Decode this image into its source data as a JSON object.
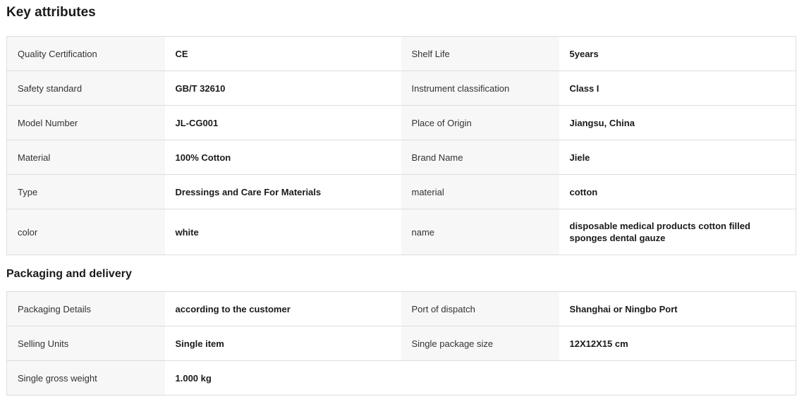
{
  "key_attributes": {
    "title": "Key attributes",
    "rows": [
      [
        "Quality Certification",
        "CE",
        "Shelf Life",
        "5years"
      ],
      [
        "Safety standard",
        "GB/T 32610",
        "Instrument classification",
        "Class I"
      ],
      [
        "Model Number",
        "JL-CG001",
        "Place of Origin",
        "Jiangsu, China"
      ],
      [
        "Material",
        "100% Cotton",
        "Brand Name",
        "Jiele"
      ],
      [
        "Type",
        "Dressings and Care For Materials",
        "material",
        "cotton"
      ],
      [
        "color",
        "white",
        "name",
        "disposable medical products cotton filled sponges dental gauze"
      ]
    ]
  },
  "packaging": {
    "title": "Packaging and delivery",
    "rows": [
      [
        "Packaging Details",
        "according to the customer",
        "Port of dispatch",
        "Shanghai or Ningbo Port"
      ],
      [
        "Selling Units",
        "Single item",
        "Single package size",
        "12X12X15 cm"
      ],
      [
        "Single gross weight",
        "1.000 kg"
      ]
    ]
  }
}
